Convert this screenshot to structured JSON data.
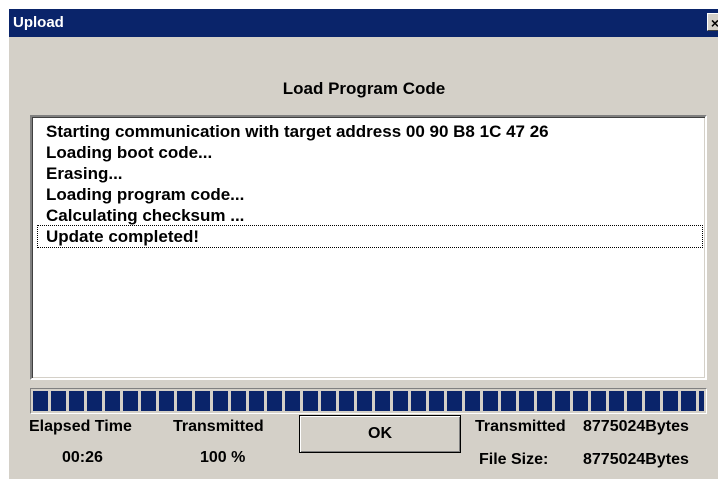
{
  "window": {
    "title": "Upload",
    "close_glyph": "×"
  },
  "heading": "Load Program Code",
  "log_lines": [
    "Starting communication with target address 00 90 B8 1C 47 26",
    "Loading boot code...",
    "Erasing...",
    "Loading program code...",
    "Calculating checksum ...",
    "Update completed!"
  ],
  "progress": {
    "fraction": 1.0
  },
  "stats": {
    "elapsed_label": "Elapsed Time",
    "elapsed_value": "00:26",
    "transmitted_label": "Transmitted",
    "transmitted_percent": "100 %",
    "transmitted_bytes_label": "Transmitted",
    "transmitted_bytes_value": "8775024Bytes",
    "file_size_label": "File Size:",
    "file_size_value": "8775024Bytes"
  },
  "ok_label": "OK",
  "colors": {
    "titlebar": "#0a246a",
    "dialog": "#d4d0c8",
    "progress": "#0a246a"
  }
}
